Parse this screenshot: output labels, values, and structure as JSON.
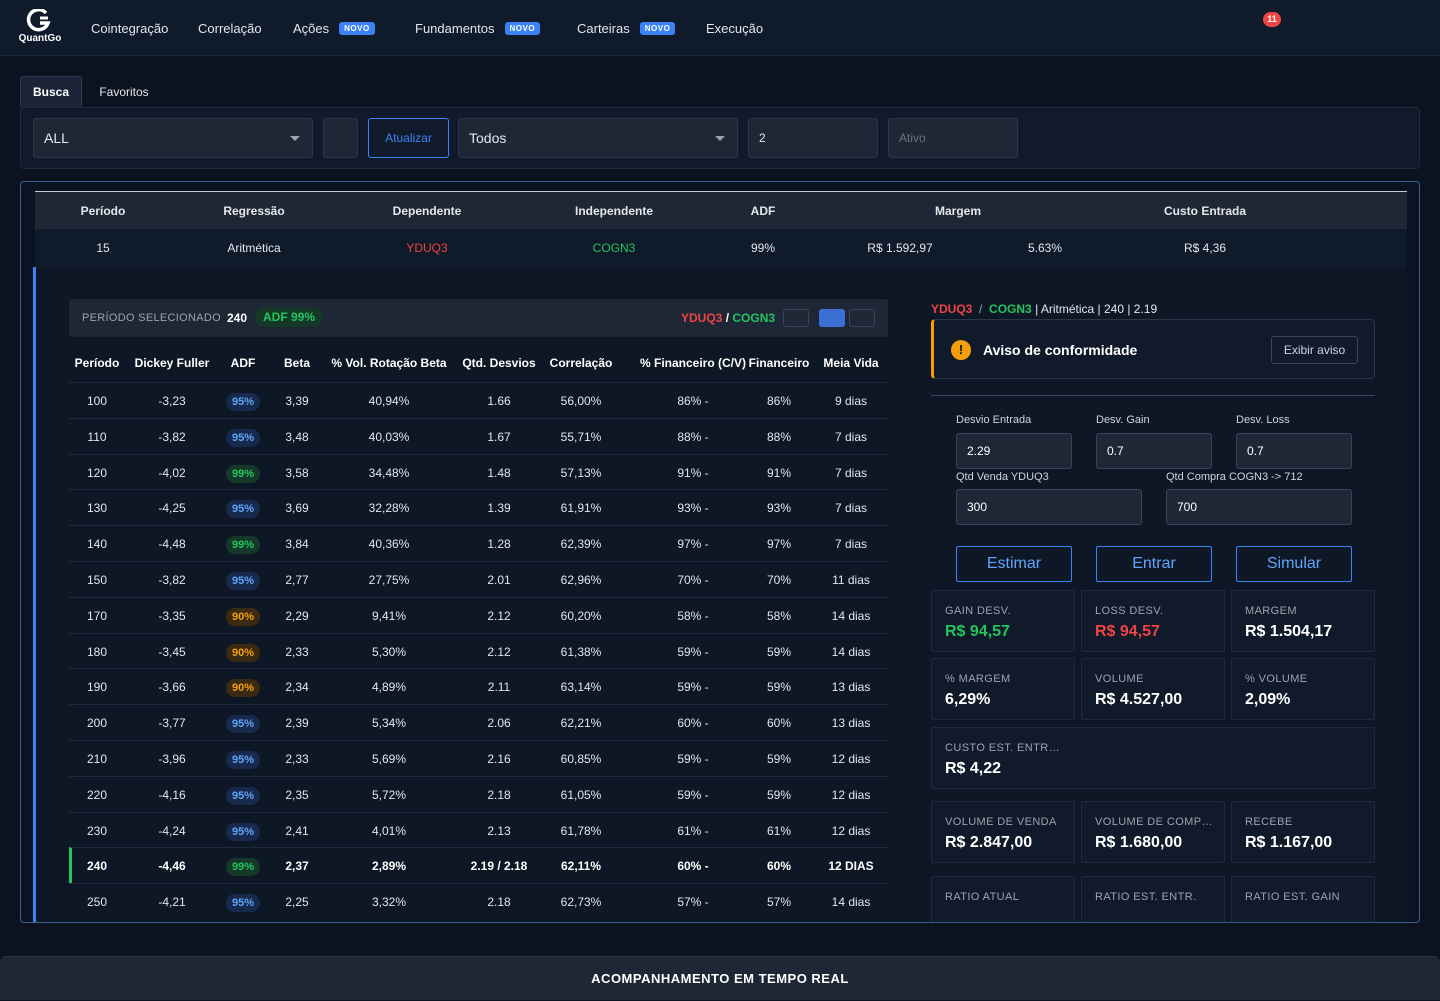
{
  "app": {
    "logo_text": "QuantGo"
  },
  "nav": [
    {
      "label": "Cointegração",
      "badge": ""
    },
    {
      "label": "Correlação",
      "badge": ""
    },
    {
      "label": "Ações",
      "badge": "NOVO"
    },
    {
      "label": "Fundamentos",
      "badge": "NOVO"
    },
    {
      "label": "Carteiras",
      "badge": "NOVO"
    },
    {
      "label": "Execução",
      "badge": ""
    }
  ],
  "notifications": {
    "count": "11"
  },
  "tabs": {
    "busca": "Busca",
    "favoritos": "Favoritos"
  },
  "filters": {
    "setor": "ALL",
    "atualizar": "Atualizar",
    "tipo": "Todos",
    "numero": "2",
    "ativo_placeholder": "Ativo"
  },
  "pair_table": {
    "headers": {
      "periodo": "Período",
      "regressao": "Regressão",
      "dependente": "Dependente",
      "independente": "Independente",
      "adf": "ADF",
      "margem": "Margem",
      "custo": "Custo Entrada"
    },
    "row": {
      "periodo": "15",
      "regressao": "Aritmética",
      "dependente": "YDUQ3",
      "independente": "COGN3",
      "adf": "99%",
      "margem": "R$ 1.592,97",
      "margem_pct": "5.63%",
      "custo": "R$ 4,36"
    }
  },
  "selection": {
    "label": "PERÍODO SELECIONADO",
    "periodo": "240",
    "adf": "ADF 99%",
    "dep": "YDUQ3",
    "sep": "/",
    "ind": "COGN3"
  },
  "period_table": {
    "headers": [
      "Período",
      "Dickey Fuller",
      "ADF",
      "Beta",
      "% Vol. Rotação Beta",
      "Qtd. Desvios",
      "Correlação",
      "% Financeiro (C/V)",
      "Financeiro",
      "Meia Vida"
    ],
    "rows": [
      [
        "100",
        "-3,23",
        "95%",
        "3,39",
        "40,94%",
        "1.66",
        "56,00%",
        "86% -",
        "86%",
        "9 dias"
      ],
      [
        "110",
        "-3,82",
        "95%",
        "3,48",
        "40,03%",
        "1.67",
        "55,71%",
        "88% -",
        "88%",
        "7 dias"
      ],
      [
        "120",
        "-4,02",
        "99%",
        "3,58",
        "34,48%",
        "1.48",
        "57,13%",
        "91% -",
        "91%",
        "7 dias"
      ],
      [
        "130",
        "-4,25",
        "95%",
        "3,69",
        "32,28%",
        "1.39",
        "61,91%",
        "93% -",
        "93%",
        "7 dias"
      ],
      [
        "140",
        "-4,48",
        "99%",
        "3,84",
        "40,36%",
        "1.28",
        "62,39%",
        "97% -",
        "97%",
        "7 dias"
      ],
      [
        "150",
        "-3,82",
        "95%",
        "2,77",
        "27,75%",
        "2.01",
        "62,96%",
        "70% -",
        "70%",
        "11 dias"
      ],
      [
        "170",
        "-3,35",
        "90%",
        "2,29",
        "9,41%",
        "2.12",
        "60,20%",
        "58% -",
        "58%",
        "14 dias"
      ],
      [
        "180",
        "-3,45",
        "90%",
        "2,33",
        "5,30%",
        "2.12",
        "61,38%",
        "59% -",
        "59%",
        "14 dias"
      ],
      [
        "190",
        "-3,66",
        "90%",
        "2,34",
        "4,89%",
        "2.11",
        "63,14%",
        "59% -",
        "59%",
        "13 dias"
      ],
      [
        "200",
        "-3,77",
        "95%",
        "2,39",
        "5,34%",
        "2.06",
        "62,21%",
        "60% -",
        "60%",
        "13 dias"
      ],
      [
        "210",
        "-3,96",
        "95%",
        "2,33",
        "5,69%",
        "2.16",
        "60,85%",
        "59% -",
        "59%",
        "12 dias"
      ],
      [
        "220",
        "-4,16",
        "95%",
        "2,35",
        "5,72%",
        "2.18",
        "61,05%",
        "59% -",
        "59%",
        "12 dias"
      ],
      [
        "230",
        "-4,24",
        "95%",
        "2,41",
        "4,01%",
        "2.13",
        "61,78%",
        "61% -",
        "61%",
        "12 dias"
      ],
      [
        "240",
        "-4,46",
        "99%",
        "2,37",
        "2,89%",
        "2.19 / 2.18",
        "62,11%",
        "60% -",
        "60%",
        "12 DIAS"
      ],
      [
        "250",
        "-4,21",
        "95%",
        "2,25",
        "3,32%",
        "2.18",
        "62,73%",
        "57% -",
        "57%",
        "14 dias"
      ]
    ],
    "selected_index": 13
  },
  "right_panel": {
    "title_dep": "YDUQ3",
    "title_sep": "/",
    "title_ind": "COGN3",
    "title_rest": "| Aritmética | 240 | 2.19",
    "aviso": {
      "icon": "!",
      "text": "Aviso de conformidade",
      "button": "Exibir aviso"
    },
    "form": {
      "desvio_entrada_label": "Desvio Entrada",
      "desvio_entrada": "2.29",
      "desv_gain_label": "Desv. Gain",
      "desv_gain": "0.7",
      "desv_loss_label": "Desv. Loss",
      "desv_loss": "0.7",
      "qtd_venda_label": "Qtd Venda YDUQ3",
      "qtd_venda": "300",
      "qtd_compra_label": "Qtd Compra COGN3 -> 712",
      "qtd_compra": "700"
    },
    "buttons": {
      "estimar": "Estimar",
      "entrar": "Entrar",
      "simular": "Simular"
    },
    "cards": [
      {
        "k": "GAIN DESV.",
        "v": "R$ 94,57",
        "color": "#22c55e"
      },
      {
        "k": "LOSS DESV.",
        "v": "R$ 94,57",
        "color": "#ef4444"
      },
      {
        "k": "MARGEM",
        "v": "R$ 1.504,17",
        "color": "#ffffff"
      },
      {
        "k": "% MARGEM",
        "v": "6,29%",
        "color": "#ffffff"
      },
      {
        "k": "VOLUME",
        "v": "R$ 4.527,00",
        "color": "#ffffff"
      },
      {
        "k": "% VOLUME",
        "v": "2,09%",
        "color": "#ffffff"
      },
      {
        "k": "CUSTO EST. ENTRADA",
        "v": "R$ 4,22",
        "color": "#ffffff"
      },
      {
        "k": "VOLUME DE VENDA",
        "v": "R$ 2.847,00",
        "color": "#ffffff"
      },
      {
        "k": "VOLUME DE COMPRA",
        "v": "R$ 1.680,00",
        "color": "#ffffff"
      },
      {
        "k": "RECEBE",
        "v": "R$ 1.167,00",
        "color": "#ffffff"
      },
      {
        "k": "RATIO ATUAL",
        "v": "",
        "color": "#ffffff"
      },
      {
        "k": "RATIO EST. ENTR.",
        "v": "",
        "color": "#ffffff"
      },
      {
        "k": "RATIO EST. GAIN",
        "v": "",
        "color": "#22c55e"
      }
    ]
  },
  "footer": {
    "label": "ACOMPANHAMENTO EM TEMPO REAL"
  }
}
